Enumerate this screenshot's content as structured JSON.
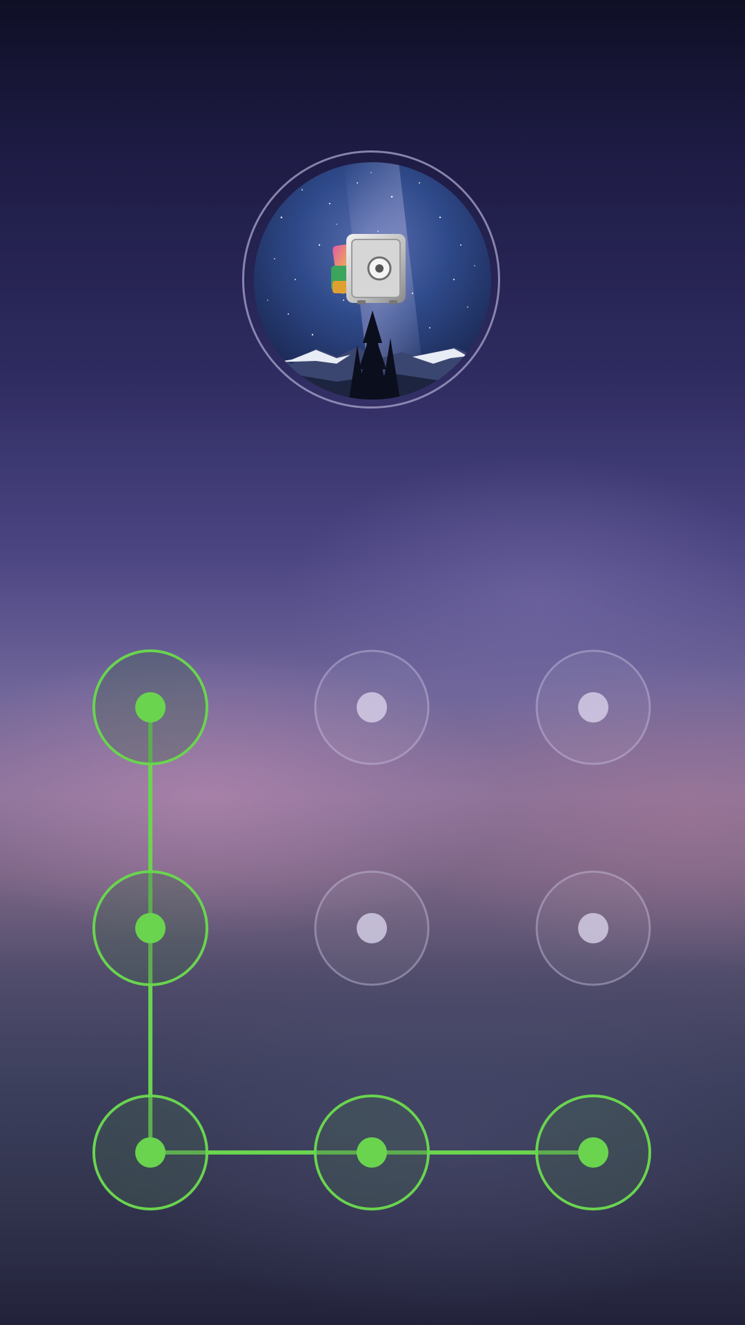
{
  "app": {
    "icon": "safe-with-photos-icon",
    "background_art": "night-sky-mountains"
  },
  "pattern_lock": {
    "accent_color": "#6ad44f",
    "idle_ring_color": "#c7bfe0",
    "idle_dot_color": "#d8d2ea",
    "grid_rows": 3,
    "grid_cols": 3,
    "selected_sequence": [
      0,
      3,
      6,
      7,
      8
    ],
    "dots": [
      {
        "index": 0,
        "selected": true
      },
      {
        "index": 1,
        "selected": false
      },
      {
        "index": 2,
        "selected": false
      },
      {
        "index": 3,
        "selected": true
      },
      {
        "index": 4,
        "selected": false
      },
      {
        "index": 5,
        "selected": false
      },
      {
        "index": 6,
        "selected": true
      },
      {
        "index": 7,
        "selected": true
      },
      {
        "index": 8,
        "selected": true
      }
    ]
  }
}
